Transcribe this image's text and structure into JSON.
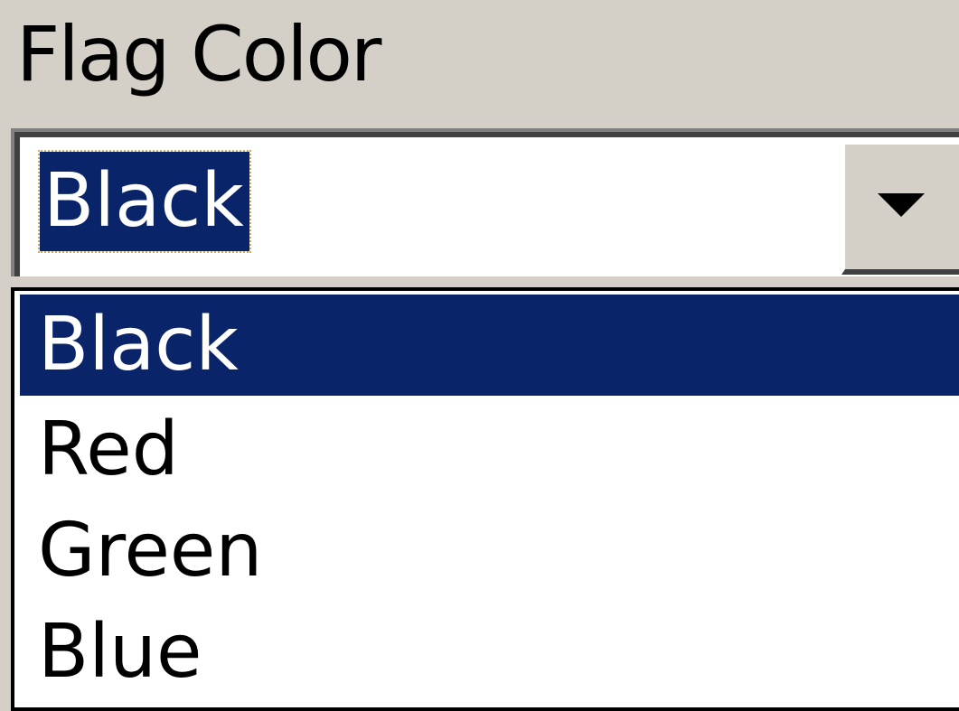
{
  "label": "Flag Color",
  "combo": {
    "value": "Black",
    "button_icon": "chevron-down-icon"
  },
  "dropdown": {
    "options": [
      {
        "label": "Black",
        "selected": true
      },
      {
        "label": "Red",
        "selected": false
      },
      {
        "label": "Green",
        "selected": false
      },
      {
        "label": "Blue",
        "selected": false
      }
    ]
  },
  "colors": {
    "highlight": "#0a246a",
    "face": "#d4d0c8"
  }
}
